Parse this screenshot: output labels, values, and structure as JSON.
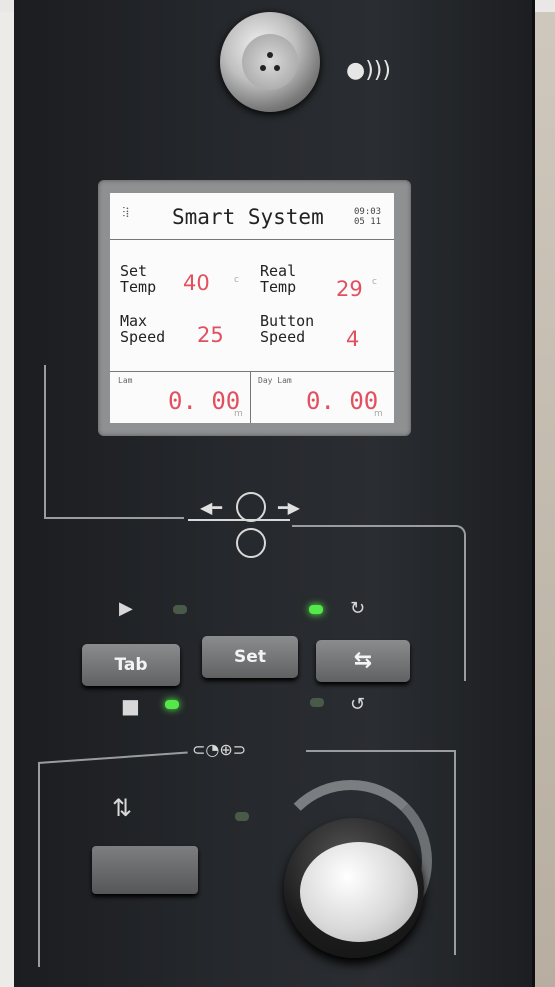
{
  "device": {
    "screen": {
      "title": "Smart System",
      "time": "09:03",
      "date": "05 11",
      "set_temp": {
        "label_1": "Set",
        "label_2": "Temp",
        "value": "40",
        "unit": "c"
      },
      "real_temp": {
        "label_1": "Real",
        "label_2": "Temp",
        "value": "29",
        "unit": "c"
      },
      "max_speed": {
        "label_1": "Max",
        "label_2": "Speed",
        "value": "25"
      },
      "button_speed": {
        "label_1": "Button",
        "label_2": "Speed",
        "value": "4"
      },
      "lam": {
        "label": "Lam",
        "value": "0. 00",
        "unit": "m"
      },
      "day_lam": {
        "label": "Day Lam",
        "value": "0. 00",
        "unit": "m"
      }
    },
    "buttons": {
      "tab": "Tab",
      "set": "Set",
      "swap": "⇆"
    },
    "leds": {
      "run": "off",
      "stop": "on",
      "rotate_cw": "on",
      "rotate_ccw": "off",
      "knob": "off"
    },
    "icons": {
      "sound": "speaker-wave-icon",
      "play": "play-icon",
      "stop": "stop-icon",
      "rotate_cw": "rotate-cw-icon",
      "rotate_ccw": "rotate-ccw-icon",
      "roller": "roller-icon",
      "speed": "speed-adjust-icon",
      "reverse": "reverse-icon"
    },
    "colors": {
      "panel": "#24272b",
      "display_value": "#e2505f",
      "led_on": "#54e84a"
    }
  }
}
